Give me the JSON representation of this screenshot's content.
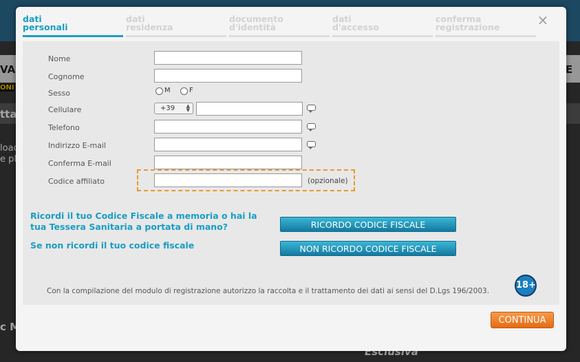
{
  "steps": [
    {
      "label": "dati\npersonali",
      "active": true
    },
    {
      "label": "dati\nresidenza",
      "active": false
    },
    {
      "label": "documento\nd'identità",
      "active": false
    },
    {
      "label": "dati\nd'accesso",
      "active": false
    },
    {
      "label": "conferma\nregistrazione",
      "active": false
    }
  ],
  "close_glyph": "×",
  "fields": {
    "nome": {
      "label": "Nome",
      "value": ""
    },
    "cognome": {
      "label": "Cognome",
      "value": ""
    },
    "sesso": {
      "label": "Sesso",
      "options": [
        "M",
        "F"
      ]
    },
    "cellulare": {
      "label": "Cellulare",
      "prefix": "+39",
      "value": ""
    },
    "telefono": {
      "label": "Telefono",
      "value": ""
    },
    "email": {
      "label": "Indirizzo E-mail",
      "value": ""
    },
    "conferma_email": {
      "label": "Conferma E-mail",
      "value": ""
    },
    "codice_affiliato": {
      "label": "Codice affiliato",
      "value": "",
      "note": "(opzionale)"
    }
  },
  "fiscal": {
    "question": "Ricordi il tuo Codice Fiscale a memoria o hai la\ntua Tessera Sanitaria a portata di mano?",
    "remember_button": "RICORDO CODICE FISCALE",
    "alt_question": "Se non ricordi il tuo codice fiscale",
    "not_remember_button": "NON RICORDO CODICE FISCALE"
  },
  "privacy_text": "Con la compilazione del modulo di registrazione autorizzo la raccolta e il trattamento dei dati ai sensi del D.Lgs 196/2003.",
  "age_badge": "18+",
  "continue_button": "CONTINUA",
  "background": {
    "fragments": [
      "VA",
      "E",
      "ONI",
      "tta",
      "loac",
      "e pl",
      "Esclusiva",
      "c M"
    ]
  },
  "colors": {
    "accent": "#1a9ec2",
    "orange": "#e56b12",
    "dashed": "#e8992e"
  }
}
